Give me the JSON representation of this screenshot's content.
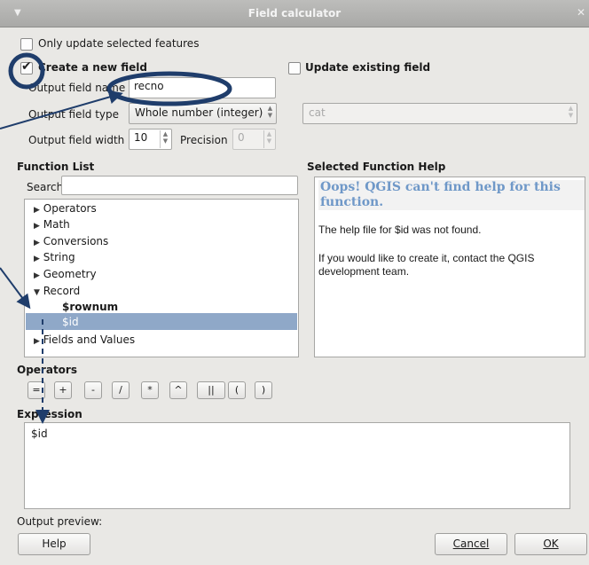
{
  "window": {
    "title": "Field calculator",
    "menu_icon": "triangle-down-icon",
    "close_icon": "close-icon"
  },
  "only_update": {
    "label": "Only update selected features",
    "checked": false
  },
  "create_new": {
    "label": "Create a new field",
    "checked": true
  },
  "update_existing": {
    "label": "Update existing field",
    "checked": false,
    "field_value": "cat"
  },
  "output_name": {
    "label": "Output field name",
    "value": "recno"
  },
  "output_type": {
    "label": "Output field type",
    "value": "Whole number (integer)"
  },
  "output_width": {
    "label": "Output field width",
    "value": "10"
  },
  "precision": {
    "label": "Precision",
    "value": "0"
  },
  "function_list": {
    "heading": "Function List",
    "search_label": "Search",
    "search_value": "",
    "items": [
      {
        "label": "Operators",
        "expanded": false
      },
      {
        "label": "Math",
        "expanded": false
      },
      {
        "label": "Conversions",
        "expanded": false
      },
      {
        "label": "String",
        "expanded": false
      },
      {
        "label": "Geometry",
        "expanded": false
      },
      {
        "label": "Record",
        "expanded": true
      },
      {
        "label": "$rownum",
        "child": true
      },
      {
        "label": "$id",
        "child": true,
        "selected": true
      },
      {
        "label": "Fields and Values",
        "expanded": false
      }
    ]
  },
  "help": {
    "heading": "Selected Function Help",
    "title": "Oops! QGIS can't find help for this function.",
    "line1": "The help file for $id was not found.",
    "line2": "If you would like to create it, contact the QGIS development team."
  },
  "operators": {
    "heading": "Operators",
    "buttons": [
      "=",
      "+",
      "-",
      "/",
      "*",
      "^",
      "||",
      "(",
      ")"
    ]
  },
  "expression": {
    "heading": "Expression",
    "value": "$id"
  },
  "preview": {
    "label": "Output preview:"
  },
  "buttons": {
    "help": "Help",
    "cancel": "Cancel",
    "ok": "OK"
  },
  "colors": {
    "selection": "#8fa8c8",
    "annotation": "#1f3d6b",
    "help_title": "#6f98c8"
  }
}
